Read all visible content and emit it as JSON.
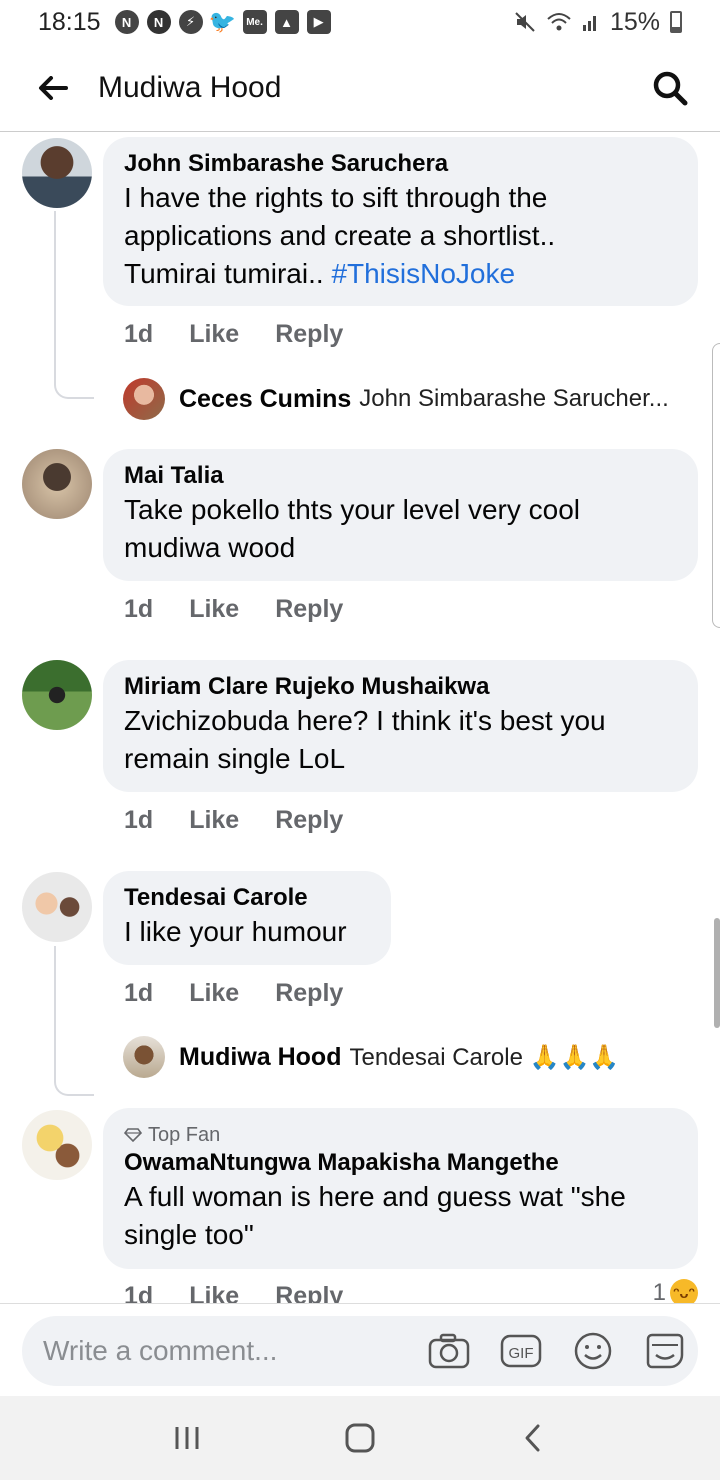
{
  "status_bar": {
    "time": "18:15",
    "battery": "15%",
    "icons": [
      "notification-n-icon",
      "nfc-icon",
      "messenger-icon",
      "twitter-icon",
      "me-icon",
      "gallery-icon",
      "youtube-icon",
      "mute-icon",
      "wifi-icon",
      "signal-icon",
      "battery-icon"
    ]
  },
  "header": {
    "title": "Mudiwa Hood",
    "back_icon": "arrow-left-icon",
    "search_icon": "search-icon"
  },
  "actions": {
    "time": "1d",
    "like": "Like",
    "reply": "Reply"
  },
  "comments": [
    {
      "author": "John Simbarashe Saruchera",
      "text_lines": [
        "I have the rights to sift through the",
        "applications and create a shortlist..",
        "Tumirai tumirai.. "
      ],
      "hashtag": "#ThisisNoJoke",
      "reply_preview": {
        "author": "Ceces Cumins",
        "text": "John Simbarashe Sarucher..."
      }
    },
    {
      "author": "Mai Talia",
      "text_lines": [
        "Take pokello thts your level very cool",
        "mudiwa wood"
      ]
    },
    {
      "author": "Miriam Clare Rujeko Mushaikwa",
      "text_lines": [
        "Zvichizobuda here? I think it's best you",
        "remain single LoL"
      ]
    },
    {
      "author": "Tendesai Carole",
      "text_lines": [
        "I like your humour"
      ],
      "reply_preview": {
        "author": "Mudiwa Hood",
        "text": "Tendesai Carole 🙏🙏🙏"
      }
    },
    {
      "badge": "Top Fan",
      "author": "OwamaNtungwa Mapakisha Mangethe",
      "text_lines": [
        "A full woman is here and guess wat \"she",
        "single too\""
      ],
      "reaction_count": "1"
    }
  ],
  "composer": {
    "placeholder": "Write a comment...",
    "icons": [
      "camera-icon",
      "gif-icon",
      "emoji-icon",
      "sticker-icon"
    ]
  },
  "colors": {
    "bubble": "#f0f2f5",
    "hashtag": "#216fdb",
    "meta_text": "#65676b"
  }
}
